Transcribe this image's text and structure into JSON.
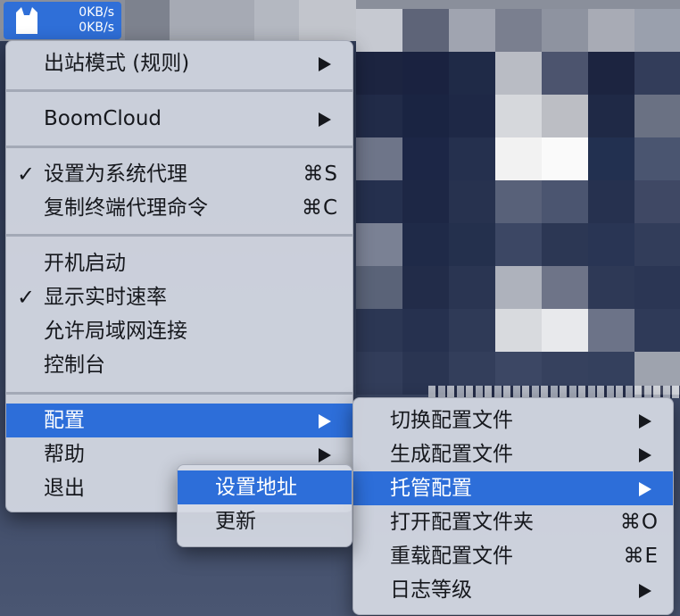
{
  "status_item": {
    "icon": "cat-icon",
    "upload_speed": "0KB/s",
    "download_speed": "0KB/s"
  },
  "main_menu": {
    "outbound_mode": "出站模式 (规则)",
    "boomcloud": "BoomCloud",
    "set_system_proxy": {
      "label": "设置为系统代理",
      "shortcut": "⌘S",
      "checked": true,
      "check_mark": "✓"
    },
    "copy_shell_command": {
      "label": "复制终端代理命令",
      "shortcut": "⌘C"
    },
    "launch_at_login": "开机启动",
    "show_speed": {
      "label": "显示实时速率",
      "checked": true,
      "check_mark": "✓"
    },
    "allow_lan": "允许局域网连接",
    "dashboard": "控制台",
    "config": "配置",
    "help": "帮助",
    "quit": "退出"
  },
  "config_submenu": {
    "switch_config": "切换配置文件",
    "generate_config": "生成配置文件",
    "remote_config": "托管配置",
    "open_config_folder": {
      "label": "打开配置文件夹",
      "shortcut": "⌘O"
    },
    "reload_config": {
      "label": "重载配置文件",
      "shortcut": "⌘E"
    },
    "log_level": "日志等级"
  },
  "remote_config_submenu": {
    "set_url": "设置地址",
    "update": "更新"
  },
  "colors": {
    "highlight": "#2d6ed9",
    "menu_background": "#d6dae4",
    "status_item_background": "#2f6fd8"
  }
}
